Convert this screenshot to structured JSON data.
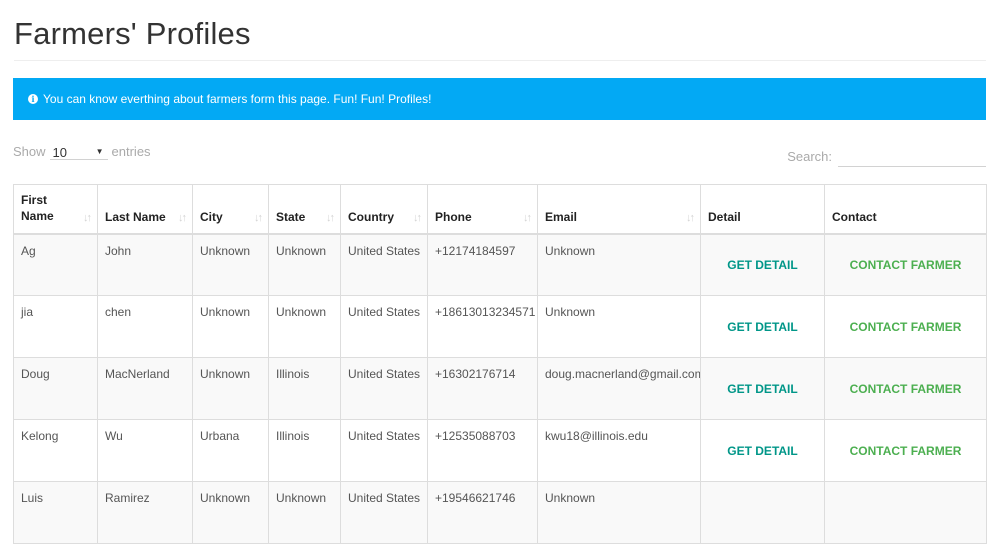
{
  "page": {
    "title": "Farmers' Profiles"
  },
  "banner": {
    "icon": "info-circle-icon",
    "text": "You can know everthing about farmers form this page. Fun! Fun! Profiles!",
    "color": "#03a9f4"
  },
  "length": {
    "show_label": "Show",
    "value": "10",
    "entries_label": "entries"
  },
  "search": {
    "label": "Search:",
    "value": ""
  },
  "table": {
    "columns": [
      {
        "label": "First Name",
        "sortable": true
      },
      {
        "label": "Last Name",
        "sortable": true
      },
      {
        "label": "City",
        "sortable": true
      },
      {
        "label": "State",
        "sortable": true
      },
      {
        "label": "Country",
        "sortable": true
      },
      {
        "label": "Phone",
        "sortable": true
      },
      {
        "label": "Email",
        "sortable": true
      },
      {
        "label": "Detail",
        "sortable": false
      },
      {
        "label": "Contact",
        "sortable": false
      }
    ],
    "rows": [
      {
        "first": "Ag",
        "last": "John",
        "city": "Unknown",
        "state": "Unknown",
        "country": "United States",
        "phone": "+12174184597",
        "email": "Unknown",
        "detail": "GET DETAIL",
        "contact": "CONTACT FARMER"
      },
      {
        "first": "jia",
        "last": "chen",
        "city": "Unknown",
        "state": "Unknown",
        "country": "United States",
        "phone": "+18613013234571",
        "email": "Unknown",
        "detail": "GET DETAIL",
        "contact": "CONTACT FARMER"
      },
      {
        "first": "Doug",
        "last": "MacNerland",
        "city": "Unknown",
        "state": "Illinois",
        "country": "United States",
        "phone": "+16302176714",
        "email": "doug.macnerland@gmail.com",
        "detail": "GET DETAIL",
        "contact": "CONTACT FARMER"
      },
      {
        "first": "Kelong",
        "last": "Wu",
        "city": "Urbana",
        "state": "Illinois",
        "country": "United States",
        "phone": "+12535088703",
        "email": "kwu18@illinois.edu",
        "detail": "GET DETAIL",
        "contact": "CONTACT FARMER"
      },
      {
        "first": "Luis",
        "last": "Ramirez",
        "city": "Unknown",
        "state": "Unknown",
        "country": "United States",
        "phone": "+19546621746",
        "email": "Unknown",
        "detail": "",
        "contact": ""
      }
    ]
  },
  "colors": {
    "detail_button": "#009688",
    "contact_button": "#4caf50"
  }
}
